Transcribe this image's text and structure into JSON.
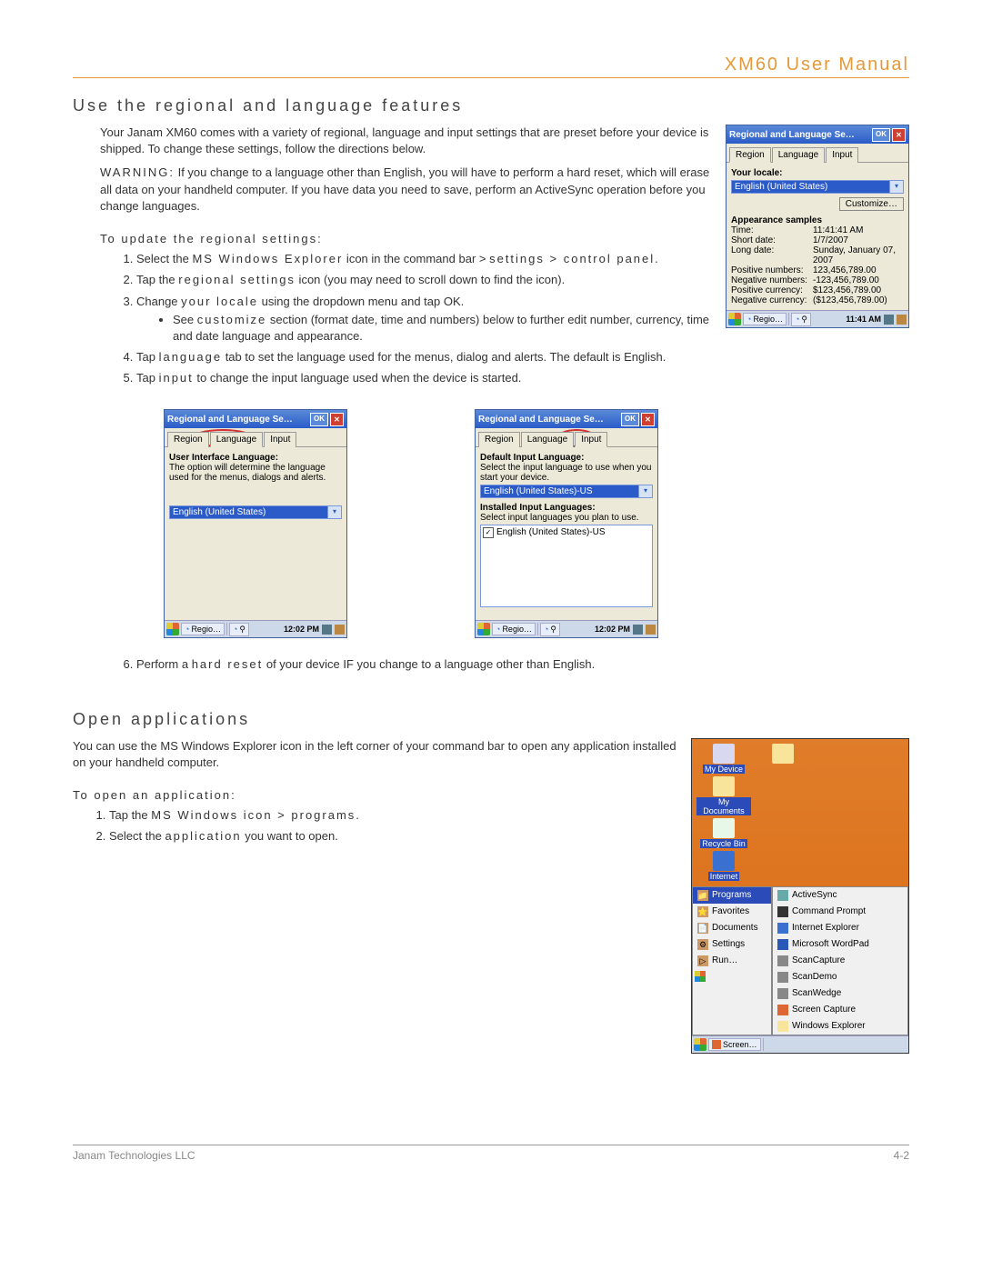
{
  "header": {
    "title": "XM60 User Manual"
  },
  "section1": {
    "heading": "Use the regional and language features",
    "intro": "Your Janam XM60 comes with a variety of regional, language and input settings that are preset before your device is shipped. To change these settings, follow the directions below.",
    "warning_pre": "WARNING:",
    "warning_txt": " If you change to a language other than English, you will have to perform a hard reset, which will erase all data on your handheld computer. If you have data you need to save, perform an ActiveSync operation before you change languages.",
    "sub1": "To update the regional settings:",
    "steps1": [
      {
        "pre": "Select the ",
        "boldA": "MS Windows Explorer",
        "midA": " icon in the command bar > ",
        "boldB": "settings > control panel",
        "end": "."
      },
      {
        "pre": "Tap the ",
        "boldA": "regional settings",
        "midA": " icon (you may need to scroll down to find the icon).",
        "boldB": "",
        "end": ""
      },
      {
        "pre": "Change ",
        "boldA": "your locale",
        "midA": " using the dropdown menu and tap OK.",
        "boldB": "",
        "end": "",
        "sub": {
          "pre": "See ",
          "boldA": "customize",
          "midA": " section (format date, time and numbers) below to further edit number, currency, time and date language and appearance."
        }
      },
      {
        "pre": "Tap ",
        "boldA": "language",
        "midA": " tab to set the language used for the menus, dialog and alerts. The default is English.",
        "boldB": "",
        "end": ""
      },
      {
        "pre": "Tap ",
        "boldA": "input",
        "midA": " to change the input language used when the device is started.",
        "boldB": "",
        "end": ""
      }
    ],
    "step6": {
      "pre": "Perform a ",
      "boldA": "hard reset",
      "midA": " of your device IF you change to a language other than English."
    }
  },
  "dlg_region": {
    "title": "Regional and Language Se…",
    "ok": "OK",
    "tabs": [
      "Region",
      "Language",
      "Input"
    ],
    "locale_lbl": "Your locale:",
    "locale_val": "English (United States)",
    "customize": "Customize…",
    "samples_lbl": "Appearance samples",
    "rows": [
      {
        "k": "Time:",
        "v": "11:41:41 AM"
      },
      {
        "k": "Short date:",
        "v": "1/7/2007"
      },
      {
        "k": "Long date:",
        "v": "Sunday, January 07, 2007"
      },
      {
        "k": "Positive numbers:",
        "v": "123,456,789.00"
      },
      {
        "k": "Negative numbers:",
        "v": "-123,456,789.00"
      },
      {
        "k": "Positive currency:",
        "v": "$123,456,789.00"
      },
      {
        "k": "Negative currency:",
        "v": "($123,456,789.00)"
      }
    ],
    "task_label": "Regio…",
    "clock": "11:41 AM"
  },
  "dlg_lang": {
    "title": "Regional and Language Se…",
    "ok": "OK",
    "tabs": [
      "Region",
      "Language",
      "Input"
    ],
    "ui_lbl": "User Interface Language:",
    "ui_txt": "The option will determine the language used for the menus, dialogs and alerts.",
    "dd_val": "English (United States)",
    "task_label": "Regio…",
    "clock": "12:02 PM"
  },
  "dlg_input": {
    "title": "Regional and Language Se…",
    "ok": "OK",
    "tabs": [
      "Region",
      "Language",
      "Input"
    ],
    "def_lbl": "Default Input Language:",
    "def_txt": "Select the input language to use when you start your device.",
    "dd_val": "English (United States)-US",
    "inst_lbl": "Installed Input Languages:",
    "inst_txt": "Select input languages you plan to use.",
    "chk_item": "English (United States)-US",
    "task_label": "Regio…",
    "clock": "12:02 PM"
  },
  "section2": {
    "heading": "Open applications",
    "intro": "You can use the MS Windows Explorer icon in the left corner of your command bar to open any application installed on your handheld computer.",
    "sub": "To open an application:",
    "steps": [
      {
        "pre": "Tap the ",
        "boldA": "MS Windows icon > programs",
        "end": "."
      },
      {
        "pre": "Select the ",
        "boldA": "application",
        "end": " you want to open."
      }
    ]
  },
  "desktop": {
    "icons": [
      {
        "label": "My Device",
        "color": "#d8d8f0"
      },
      {
        "label": "My Documents",
        "color": "#f8e49a"
      },
      {
        "label": "Recycle Bin",
        "color": "#e8f8e8"
      },
      {
        "label": "Internet",
        "color": "#3a70d0"
      }
    ],
    "start_menu": [
      "Programs",
      "Favorites",
      "Documents",
      "Settings",
      "Run…"
    ],
    "start_sel": 0,
    "programs": [
      "ActiveSync",
      "Command Prompt",
      "Internet Explorer",
      "Microsoft WordPad",
      "ScanCapture",
      "ScanDemo",
      "ScanWedge",
      "Screen Capture",
      "Windows Explorer"
    ],
    "task_label": "Screen…"
  },
  "footer": {
    "company": "Janam Technologies LLC",
    "page": "4-2"
  }
}
